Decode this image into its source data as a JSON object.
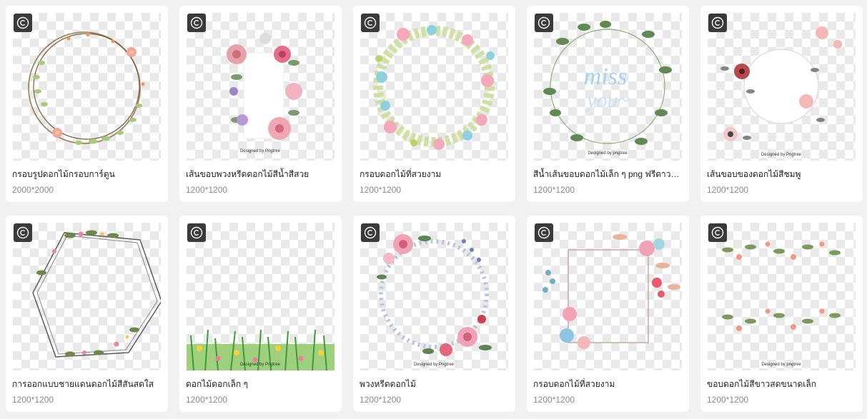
{
  "icons": {
    "badge": "copyright-icon"
  },
  "cards": [
    {
      "title": "กรอบรูปดอกไม้กรอบการ์ตูน",
      "size": "2000*2000",
      "watermark": ""
    },
    {
      "title": "เส้นขอบพวงหรีดดอกไม้สีน้ำสีสวย",
      "size": "1200*1200",
      "watermark": "Designed by Pngtree"
    },
    {
      "title": "กรอบดอกไม้ที่สวยงาม",
      "size": "1200*1200",
      "watermark": ""
    },
    {
      "title": "สีน้ำเส้นขอบดอกไม้เล็ก ๆ png ฟรีดาวน์โหลด",
      "size": "1200*1200",
      "watermark": "Designed by pngtree",
      "art_text": "miss",
      "art_text2": "you~"
    },
    {
      "title": "เส้นขอบของดอกไม้สีชมพู",
      "size": "1200*1200",
      "watermark": "Designed by Pngtree"
    },
    {
      "title": "การออกแบบชายแดนดอกไม้สีสันสดใส",
      "size": "1200*1200",
      "watermark": ""
    },
    {
      "title": "ดอกไม้ดอกเล็ก ๆ",
      "size": "1200*1200",
      "watermark": "Designed by Pngtree"
    },
    {
      "title": "พวงหรีดดอกไม้",
      "size": "1200*1200",
      "watermark": "Designed by Pngtree"
    },
    {
      "title": "กรอบดอกไม้ที่สวยงาม",
      "size": "1200*1200",
      "watermark": ""
    },
    {
      "title": "ขอบดอกไม้สีขาวสดขนาดเล็ก",
      "size": "1200*1200",
      "watermark": "Designed by pngtree"
    }
  ]
}
